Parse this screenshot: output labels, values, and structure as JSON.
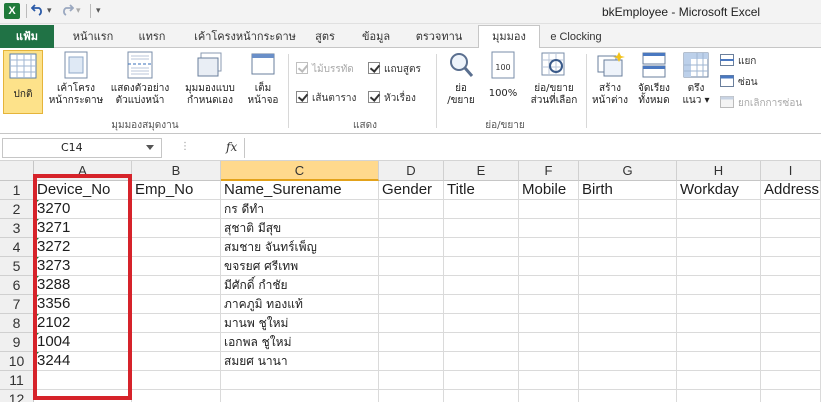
{
  "title_bar": {
    "app_icon": "X",
    "title": "bkEmployee  -  Microsoft Excel",
    "qat_icons": [
      "save-icon",
      "undo-icon",
      "redo-icon",
      "customize-icon"
    ]
  },
  "tabs": {
    "file": "แฟ้ม",
    "items": [
      "หน้าแรก",
      "แทรก",
      "เค้าโครงหน้ากระดาษ",
      "สูตร",
      "ข้อมูล",
      "ตรวจทาน",
      "มุมมอง",
      "e Clocking"
    ],
    "active": "มุมมอง"
  },
  "ribbon": {
    "workbook_views": {
      "normal": "ปกติ",
      "page_layout": [
        "เค้าโครง",
        "หน้ากระดาษ"
      ],
      "page_break": [
        "แสดงตัวอย่าง",
        "ตัวแบ่งหน้า"
      ],
      "custom_views": [
        "มุมมองแบบ",
        "กำหนดเอง"
      ],
      "full_screen": [
        "เต็ม",
        "หน้าจอ"
      ],
      "label": "มุมมองสมุดงาน"
    },
    "show": {
      "ruler": "ไม้บรรทัด",
      "formula_bar": "แถบสูตร",
      "gridlines": "เส้นตาราง",
      "headings": "หัวเรื่อง",
      "label": "แสดง"
    },
    "zoom": {
      "zoom": [
        "ย่อ",
        "/ขยาย"
      ],
      "zoom_100": "100%",
      "zoom_selection": [
        "ย่อ/ขยาย",
        "ส่วนที่เลือก"
      ],
      "label": "ย่อ/ขยาย"
    },
    "window": {
      "new_window": [
        "สร้าง",
        "หน้าต่าง"
      ],
      "arrange_all": [
        "จัดเรียง",
        "ทั้งหมด"
      ],
      "freeze": [
        "ตรึง",
        "แนว"
      ],
      "split": "แยก",
      "hide": "ซ่อน",
      "unhide": "ยกเลิกการซ่อน"
    }
  },
  "formula_bar": {
    "name_box": "C14",
    "fx": "fx",
    "content": ""
  },
  "sheet": {
    "columns": [
      "A",
      "B",
      "C",
      "D",
      "E",
      "F",
      "G",
      "H",
      "I"
    ],
    "active_column": "C",
    "rows": [
      "1",
      "2",
      "3",
      "4",
      "5",
      "6",
      "7",
      "8",
      "9",
      "10",
      "11",
      "12"
    ],
    "header": [
      "Device_No",
      "Emp_No",
      "Name_Surename",
      "Gender",
      "Title",
      "Mobile",
      "Birth",
      "Workday",
      "Address"
    ],
    "data": [
      [
        "3270",
        "",
        "กร ดีทำ"
      ],
      [
        "3271",
        "",
        "สุชาติ มีสุข"
      ],
      [
        "3272",
        "",
        "สมชาย จันทร์เพ็ญ"
      ],
      [
        "3273",
        "",
        "ขจรยศ ศรีเทพ"
      ],
      [
        "3288",
        "",
        "มีศักดิ์ กำชัย"
      ],
      [
        "3356",
        "",
        "ภาคภูมิ ทองแท้"
      ],
      [
        "2102",
        "",
        "มานพ ชูใหม่"
      ],
      [
        "1004",
        "",
        "เอกพล ชูใหม่"
      ],
      [
        "3244",
        "",
        "สมยศ นานา"
      ]
    ]
  },
  "colors": {
    "file_tab": "#207245",
    "highlight_box": "#d6232a",
    "active_header": "#ffd98d",
    "text_flag": "#1e7b3c"
  }
}
